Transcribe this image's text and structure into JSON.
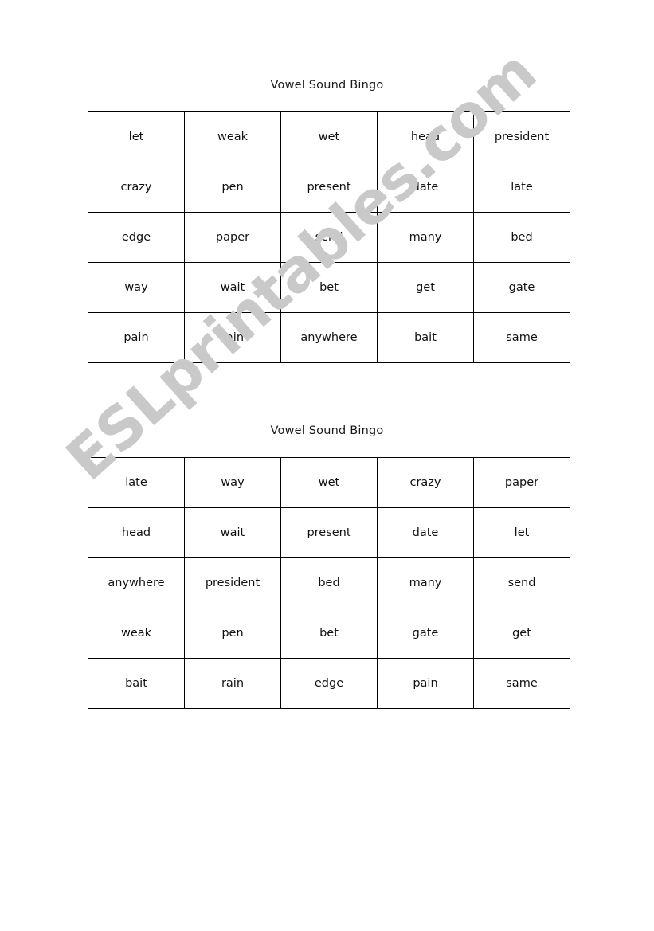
{
  "document": {
    "page_background": "#ffffff",
    "text_color": "#111111",
    "border_color": "#000000"
  },
  "watermark": {
    "text": "ESLprintables.com",
    "color": "#c9c9c9",
    "rotation_deg": -42
  },
  "cards": [
    {
      "title": "Vowel Sound Bingo",
      "rows": [
        [
          "let",
          "weak",
          "wet",
          "head",
          "president"
        ],
        [
          "crazy",
          "pen",
          "present",
          "date",
          "late"
        ],
        [
          "edge",
          "paper",
          "send",
          "many",
          "bed"
        ],
        [
          "way",
          "wait",
          "bet",
          "get",
          "gate"
        ],
        [
          "pain",
          "rain",
          "anywhere",
          "bait",
          "same"
        ]
      ]
    },
    {
      "title": "Vowel Sound Bingo",
      "rows": [
        [
          "late",
          "way",
          "wet",
          "crazy",
          "paper"
        ],
        [
          "head",
          "wait",
          "present",
          "date",
          "let"
        ],
        [
          "anywhere",
          "president",
          "bed",
          "many",
          "send"
        ],
        [
          "weak",
          "pen",
          "bet",
          "gate",
          "get"
        ],
        [
          "bait",
          "rain",
          "edge",
          "pain",
          "same"
        ]
      ]
    }
  ]
}
